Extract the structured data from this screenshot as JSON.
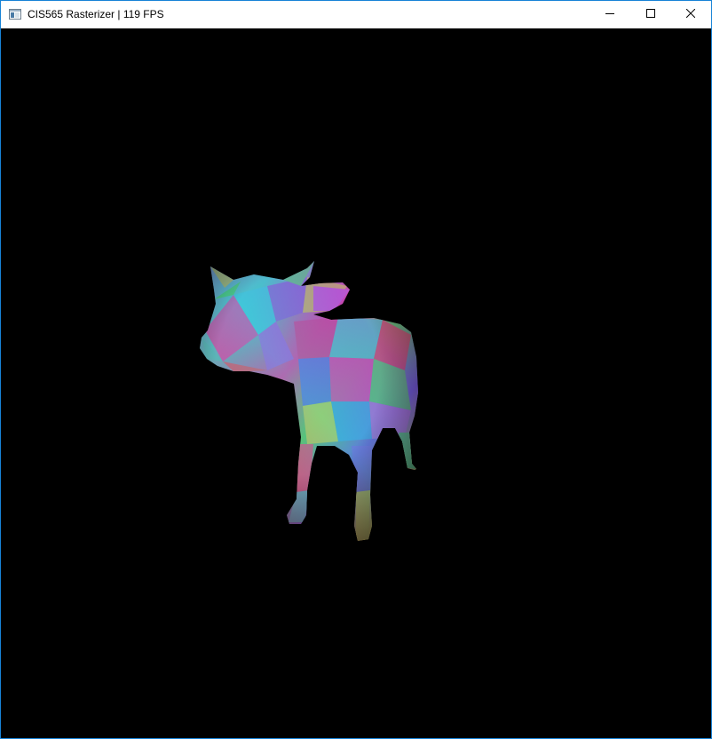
{
  "window": {
    "title": "CIS565 Rasterizer | 119 FPS",
    "border_color": "#1883d7"
  },
  "titlebar": {
    "app_icon": "application-window-icon",
    "buttons": [
      {
        "name": "minimize-button",
        "icon": "minimize-icon"
      },
      {
        "name": "maximize-button",
        "icon": "maximize-icon"
      },
      {
        "name": "close-button",
        "icon": "close-icon"
      }
    ]
  },
  "viewport": {
    "background": "#000000",
    "model": "cow",
    "shading": "per-vertex normal colors"
  }
}
